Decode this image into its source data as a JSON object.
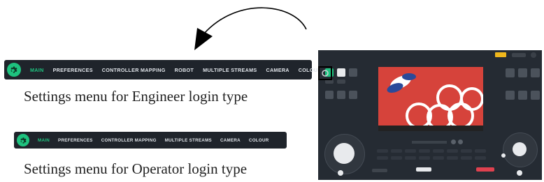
{
  "engineer_menu": {
    "items": [
      "MAIN",
      "PREFERENCES",
      "CONTROLLER MAPPING",
      "ROBOT",
      "MULTIPLE STREAMS",
      "CAMERA",
      "COLOUR"
    ],
    "active": "MAIN"
  },
  "operator_menu": {
    "items": [
      "MAIN",
      "PREFERENCES",
      "CONTROLLER MAPPING",
      "MULTIPLE STREAMS",
      "CAMERA",
      "COLOUR"
    ],
    "active": "MAIN"
  },
  "captions": {
    "engineer": "Settings menu for Engineer login type",
    "operator": "Settings menu for Operator login type"
  },
  "colors": {
    "accent": "#1ec37f",
    "menu_bg": "#1f242b",
    "app_bg": "#252b33",
    "record_red": "#e0414f"
  },
  "icons": {
    "settings": "gear-icon",
    "pointer": "curved-arrow-icon"
  }
}
